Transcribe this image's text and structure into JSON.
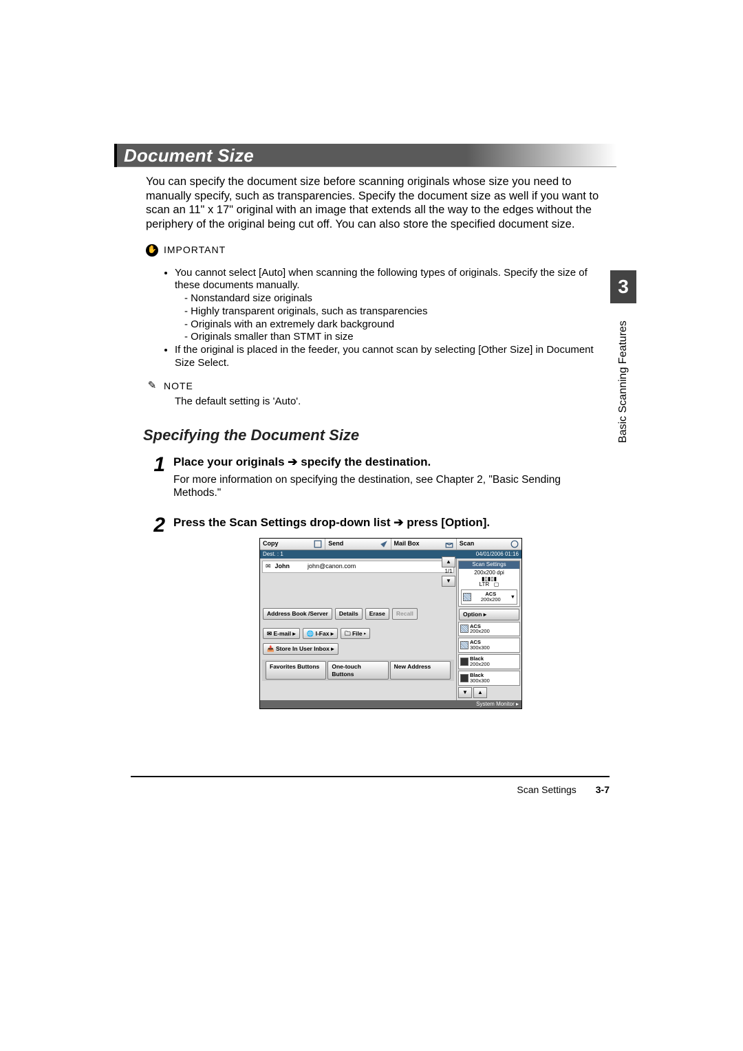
{
  "heading": "Document Size",
  "intro": "You can specify the document size before scanning originals whose size you need to manually specify, such as transparencies. Specify the document size as well if you want to scan an 11\" x 17\" original with an image that extends all the way to the edges without the periphery of the original being cut off. You can also store the specified document size.",
  "important_label": "IMPORTANT",
  "important_items": [
    "You cannot select [Auto] when scanning the following types of originals. Specify the size of these documents manually."
  ],
  "important_sub": [
    "Nonstandard size originals",
    "Highly transparent originals, such as transparencies",
    "Originals with an extremely dark background",
    "Originals smaller than STMT in size"
  ],
  "important_item2": "If the original is placed in the feeder, you cannot scan by selecting [Other Size] in Document Size Select.",
  "note_label": "NOTE",
  "note_text": "The default setting is 'Auto'.",
  "subheading": "Specifying the Document Size",
  "step1_num": "1",
  "step1_title_a": "Place your originals",
  "step1_title_b": "specify the destination.",
  "step1_desc": "For more information on specifying the destination, see Chapter 2, \"Basic Sending Methods.\"",
  "step2_num": "2",
  "step2_title_a": "Press the Scan Settings drop-down list",
  "step2_title_b": "press [Option].",
  "side_tab_num": "3",
  "side_label": "Basic Scanning Features",
  "footer_section": "Scan Settings",
  "footer_page": "3-7",
  "ui": {
    "tabs": [
      "Copy",
      "Send",
      "Mail Box",
      "Scan"
    ],
    "status_left": "Dest. :   1",
    "status_right": "04/01/2006 01:16",
    "dest_name": "John",
    "dest_addr": "john@canon.com",
    "pager": "1/1",
    "btn_addr": "Address Book /Server",
    "btn_details": "Details",
    "btn_erase": "Erase",
    "btn_recall": "Recall",
    "btn_email": "E-mail",
    "btn_ifax": "I-Fax",
    "btn_file": "File",
    "btn_store": "Store In User Inbox",
    "bot_fav": "Favorites Buttons",
    "bot_one": "One-touch Buttons",
    "bot_new": "New Address",
    "right_title": "Scan Settings",
    "right_dpi": "200x200 dpi",
    "right_ltr": "LTR",
    "right_cur_mode": "ACS",
    "right_cur_dpi": "200x200",
    "right_option": "Option",
    "opts": [
      {
        "mode": "ACS",
        "dpi": "200x200"
      },
      {
        "mode": "ACS",
        "dpi": "300x300"
      },
      {
        "mode": "Black",
        "dpi": "200x200"
      },
      {
        "mode": "Black",
        "dpi": "300x300"
      }
    ],
    "sysmon": "System Monitor"
  }
}
